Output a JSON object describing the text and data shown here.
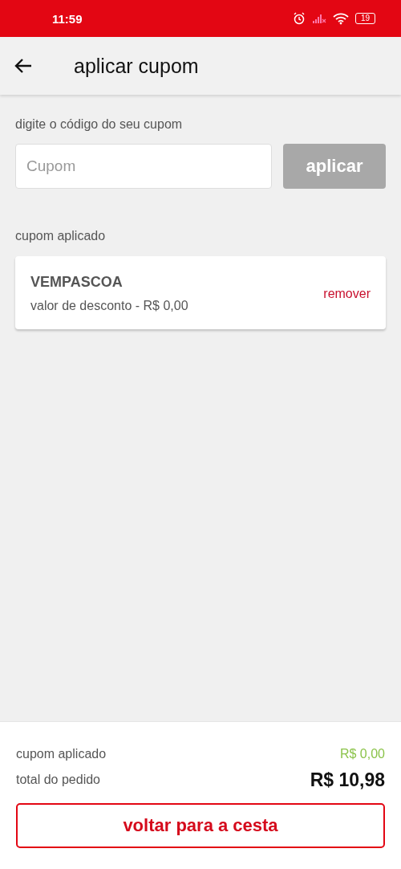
{
  "status_bar": {
    "time": "11:59",
    "battery": "19"
  },
  "header": {
    "title": "aplicar cupom"
  },
  "coupon_form": {
    "label": "digite o código do seu cupom",
    "placeholder": "Cupom",
    "button": "aplicar",
    "disabled": true
  },
  "applied": {
    "label": "cupom aplicado",
    "code": "VEMPASCOA",
    "discount": "valor de desconto - R$ 0,00",
    "remove": "remover"
  },
  "summary": {
    "rows": [
      {
        "kind": "discount",
        "label": "cupom aplicado",
        "value": "R$ 0,00"
      },
      {
        "kind": "total",
        "label": "total do pedido",
        "value": "R$ 10,98"
      }
    ],
    "button": "voltar para a cesta"
  }
}
